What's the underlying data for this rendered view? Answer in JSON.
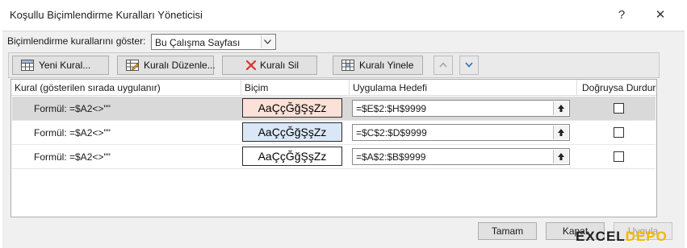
{
  "window": {
    "title": "Koşullu Biçimlendirme Kuralları Yöneticisi",
    "help_glyph": "?",
    "close_glyph": "✕"
  },
  "show_rules": {
    "label": "Biçimlendirme kurallarını göster:",
    "selected": "Bu Çalışma Sayfası"
  },
  "toolbar": {
    "new_rule": "Yeni Kural...",
    "edit_rule": "Kuralı Düzenle...",
    "delete_rule": "Kuralı Sil",
    "duplicate_rule": "Kuralı Yinele"
  },
  "columns": {
    "rule": "Kural (gösterilen sırada uygulanır)",
    "format": "Biçim",
    "applies_to": "Uygulama Hedefi",
    "stop_if_true": "Doğruysa Durdur"
  },
  "rules": [
    {
      "rule": "Formül: =$A2<>\"\"",
      "preview": "AaÇçĞğŞşZz",
      "fill": "#fbe1d7",
      "applies_to": "=$E$2:$H$9999",
      "stop_if_true": false,
      "selected": true
    },
    {
      "rule": "Formül: =$A2<>\"\"",
      "preview": "AaÇçĞğŞşZz",
      "fill": "#dae7f6",
      "applies_to": "=$C$2:$D$9999",
      "stop_if_true": false,
      "selected": false
    },
    {
      "rule": "Formül: =$A2<>\"\"",
      "preview": "AaÇçĞğŞşZz",
      "fill": "#ffffff",
      "applies_to": "=$A$2:$B$9999",
      "stop_if_true": false,
      "selected": false
    }
  ],
  "buttons": {
    "ok": "Tamam",
    "close": "Kapat",
    "apply": "Uygula"
  },
  "watermark": {
    "part1": "EXCEL",
    "part2": "DEPO"
  }
}
